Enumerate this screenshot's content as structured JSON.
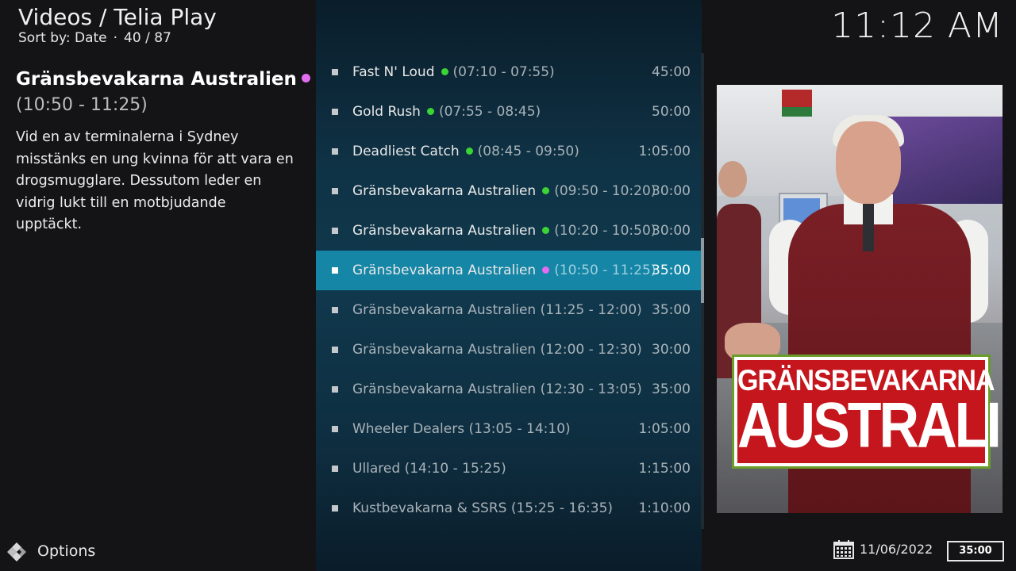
{
  "header": {
    "title": "Videos / Telia Play",
    "sort_label": "Sort by: Date",
    "separator": "·",
    "position": "40 / 87"
  },
  "clock": "11:12 AM",
  "info": {
    "title": "Gränsbevakarna Australien",
    "time": "(10:50 - 11:25)",
    "description": "Vid en av terminalerna i Sydney misstänks en ung kvinna för att vara en drogsmugglare. Dessutom leder en vidrig lukt till en motbjudande upptäckt."
  },
  "colors": {
    "accent": "#1686a6",
    "recorded_dot": "#3bd435",
    "playing_dot": "#e26df0",
    "panel": "#10384d"
  },
  "list": [
    {
      "title": "Fast N' Loud",
      "time": "(07:10 - 07:55)",
      "duration": "45:00",
      "dot": "green"
    },
    {
      "title": "Gold Rush",
      "time": "(07:55 - 08:45)",
      "duration": "50:00",
      "dot": "green"
    },
    {
      "title": "Deadliest Catch",
      "time": "(08:45 - 09:50)",
      "duration": "1:05:00",
      "dot": "green"
    },
    {
      "title": "Gränsbevakarna Australien",
      "time": "(09:50 - 10:20)",
      "duration": "30:00",
      "dot": "green"
    },
    {
      "title": "Gränsbevakarna Australien",
      "time": "(10:20 - 10:50)",
      "duration": "30:00",
      "dot": "green"
    },
    {
      "title": "Gränsbevakarna Australien",
      "time": "(10:50 - 11:25)",
      "duration": "35:00",
      "dot": "pink",
      "selected": true
    },
    {
      "title": "Gränsbevakarna Australien",
      "time": "(11:25 - 12:00)",
      "duration": "35:00",
      "dot": "none"
    },
    {
      "title": "Gränsbevakarna Australien",
      "time": "(12:00 - 12:30)",
      "duration": "30:00",
      "dot": "none"
    },
    {
      "title": "Gränsbevakarna Australien",
      "time": "(12:30 - 13:05)",
      "duration": "35:00",
      "dot": "none"
    },
    {
      "title": "Wheeler Dealers",
      "time": "(13:05 - 14:10)",
      "duration": "1:05:00",
      "dot": "none"
    },
    {
      "title": "Ullared",
      "time": "(14:10 - 15:25)",
      "duration": "1:15:00",
      "dot": "none"
    },
    {
      "title": "Kustbevakarna & SSRS",
      "time": "(15:25 - 16:35)",
      "duration": "1:10:00",
      "dot": "none"
    }
  ],
  "poster": {
    "logo_line1": "GRÄNSBEVAKARNA",
    "logo_line2": "AUSTRALIEN"
  },
  "footer": {
    "options_label": "Options",
    "options_icon": "kodi-logo-icon",
    "calendar_icon": "calendar-icon",
    "date": "11/06/2022",
    "duration": "35:00"
  }
}
